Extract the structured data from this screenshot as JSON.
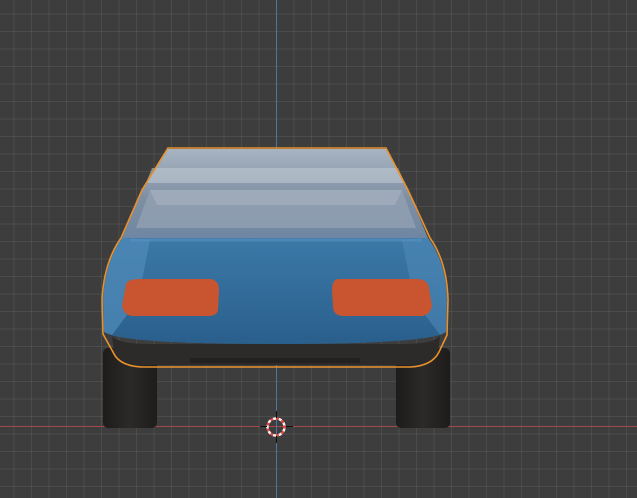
{
  "viewport": {
    "view": "front-orthographic",
    "grid": true,
    "colors": {
      "background": "#3d3d3d",
      "grid_line": "#4a4a4a",
      "axis_z": "#4f7db3",
      "axis_x": "#b34a4a",
      "selection_outline": "#e8922e"
    }
  },
  "object": {
    "kind": "car-mesh",
    "selected": true,
    "colors": {
      "body": "#2f6a99",
      "body_light": "#4f89b8",
      "glass": "#8a9aac",
      "taillight": "#c8552f",
      "bumper": "#2d2b2a",
      "tire": "#262422"
    }
  },
  "cursor_3d": {
    "icon": "3d-cursor-icon"
  }
}
